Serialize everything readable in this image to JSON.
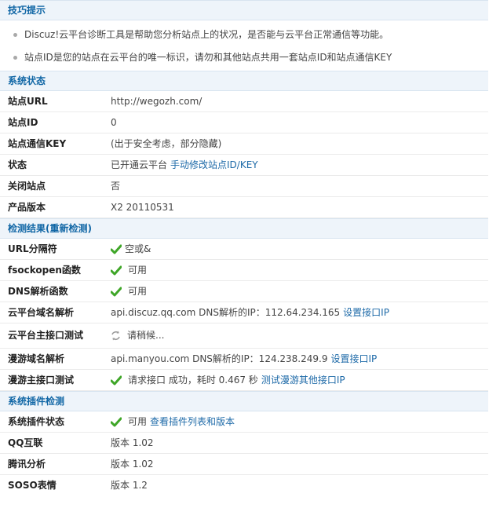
{
  "tips": {
    "title": "技巧提示",
    "items": [
      "Discuz!云平台诊断工具是帮助您分析站点上的状况，是否能与云平台正常通信等功能。",
      "站点ID是您的站点在云平台的唯一标识，请勿和其他站点共用一套站点ID和站点通信KEY"
    ]
  },
  "system_status": {
    "title": "系统状态",
    "rows": [
      {
        "label": "站点URL",
        "value": "http://wegozh.com/"
      },
      {
        "label": "站点ID",
        "value": "0"
      },
      {
        "label": "站点通信KEY",
        "value": "(出于安全考虑，部分隐藏)"
      },
      {
        "label": "状态",
        "value": "已开通云平台",
        "link": "手动修改站点ID/KEY"
      },
      {
        "label": "关闭站点",
        "value": "否"
      },
      {
        "label": "产品版本",
        "value": "X2 20110531"
      }
    ]
  },
  "detection": {
    "title": "检测结果(重新检测)",
    "rows": [
      {
        "label": "URL分隔符",
        "value": "空或&",
        "icon": "check-icon"
      },
      {
        "label": "fsockopen函数",
        "value": "可用",
        "icon": "check-icon"
      },
      {
        "label": "DNS解析函数",
        "value": "可用",
        "icon": "check-icon"
      },
      {
        "label": "云平台域名解析",
        "value": "api.discuz.qq.com DNS解析的IP：112.64.234.165",
        "link": "设置接口IP"
      },
      {
        "label": "云平台主接口测试",
        "value": "请稍候...",
        "icon": "loading-icon"
      },
      {
        "label": "漫游域名解析",
        "value": "api.manyou.com DNS解析的IP：124.238.249.9",
        "link": "设置接口IP"
      },
      {
        "label": "漫游主接口测试",
        "value": "请求接口 成功，耗时 0.467 秒",
        "link": "测试漫游其他接口IP",
        "icon": "check-icon"
      }
    ]
  },
  "plugins": {
    "title": "系统插件检测",
    "rows": [
      {
        "label": "系统插件状态",
        "value": "可用",
        "link": "查看插件列表和版本",
        "icon": "check-icon"
      },
      {
        "label": "QQ互联",
        "value": "版本 1.02"
      },
      {
        "label": "腾讯分析",
        "value": "版本 1.02"
      },
      {
        "label": "SOSO表情",
        "value": "版本 1.2"
      }
    ]
  },
  "colors": {
    "header_bg": "#eef4fa",
    "header_text": "#1066a5",
    "link": "#1e6aa8",
    "check": "#3fa628"
  }
}
